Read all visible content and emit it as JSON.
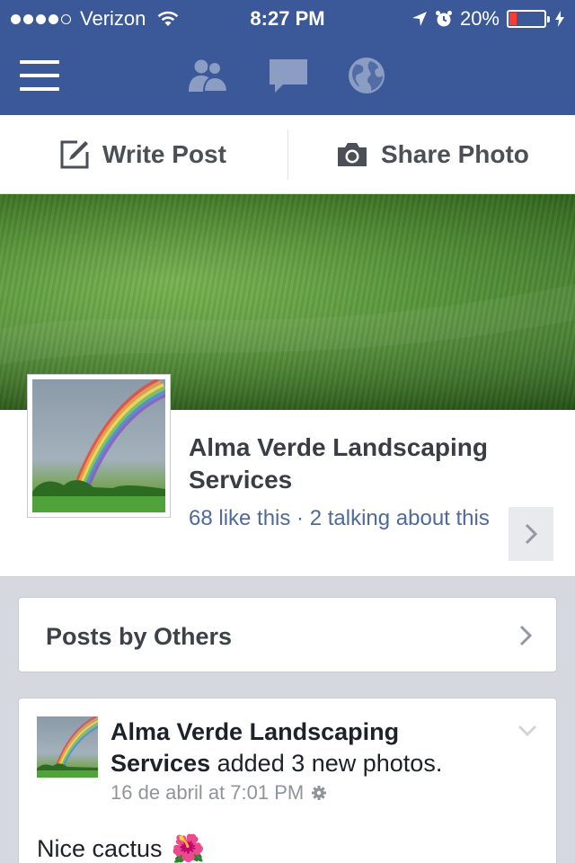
{
  "status_bar": {
    "carrier": "Verizon",
    "time": "8:27 PM",
    "battery": "20%",
    "battery_level": 0.2,
    "icons": [
      "signal-dots-icon",
      "wifi-icon",
      "location-arrow-icon",
      "alarm-icon",
      "battery-icon",
      "charging-bolt-icon"
    ]
  },
  "nav": {
    "icons": [
      "menu-icon",
      "friend-requests-icon",
      "messages-icon",
      "notifications-globe-icon"
    ]
  },
  "actions": {
    "write_post": "Write Post",
    "share_photo": "Share Photo"
  },
  "page": {
    "name": "Alma Verde Landscaping Services",
    "stats": "68 like this · 2 talking about this"
  },
  "sections": {
    "posts_by_others": "Posts by Others"
  },
  "post": {
    "author": "Alma Verde Landscaping Services",
    "action": "added 3 new photos.",
    "timestamp": "16 de abril at 7:01 PM",
    "text": "Nice cactus",
    "emoji": "🌺"
  },
  "colors": {
    "brand": "#3b5998",
    "link": "#4e6a9b",
    "battery_low": "#ff3b30"
  }
}
